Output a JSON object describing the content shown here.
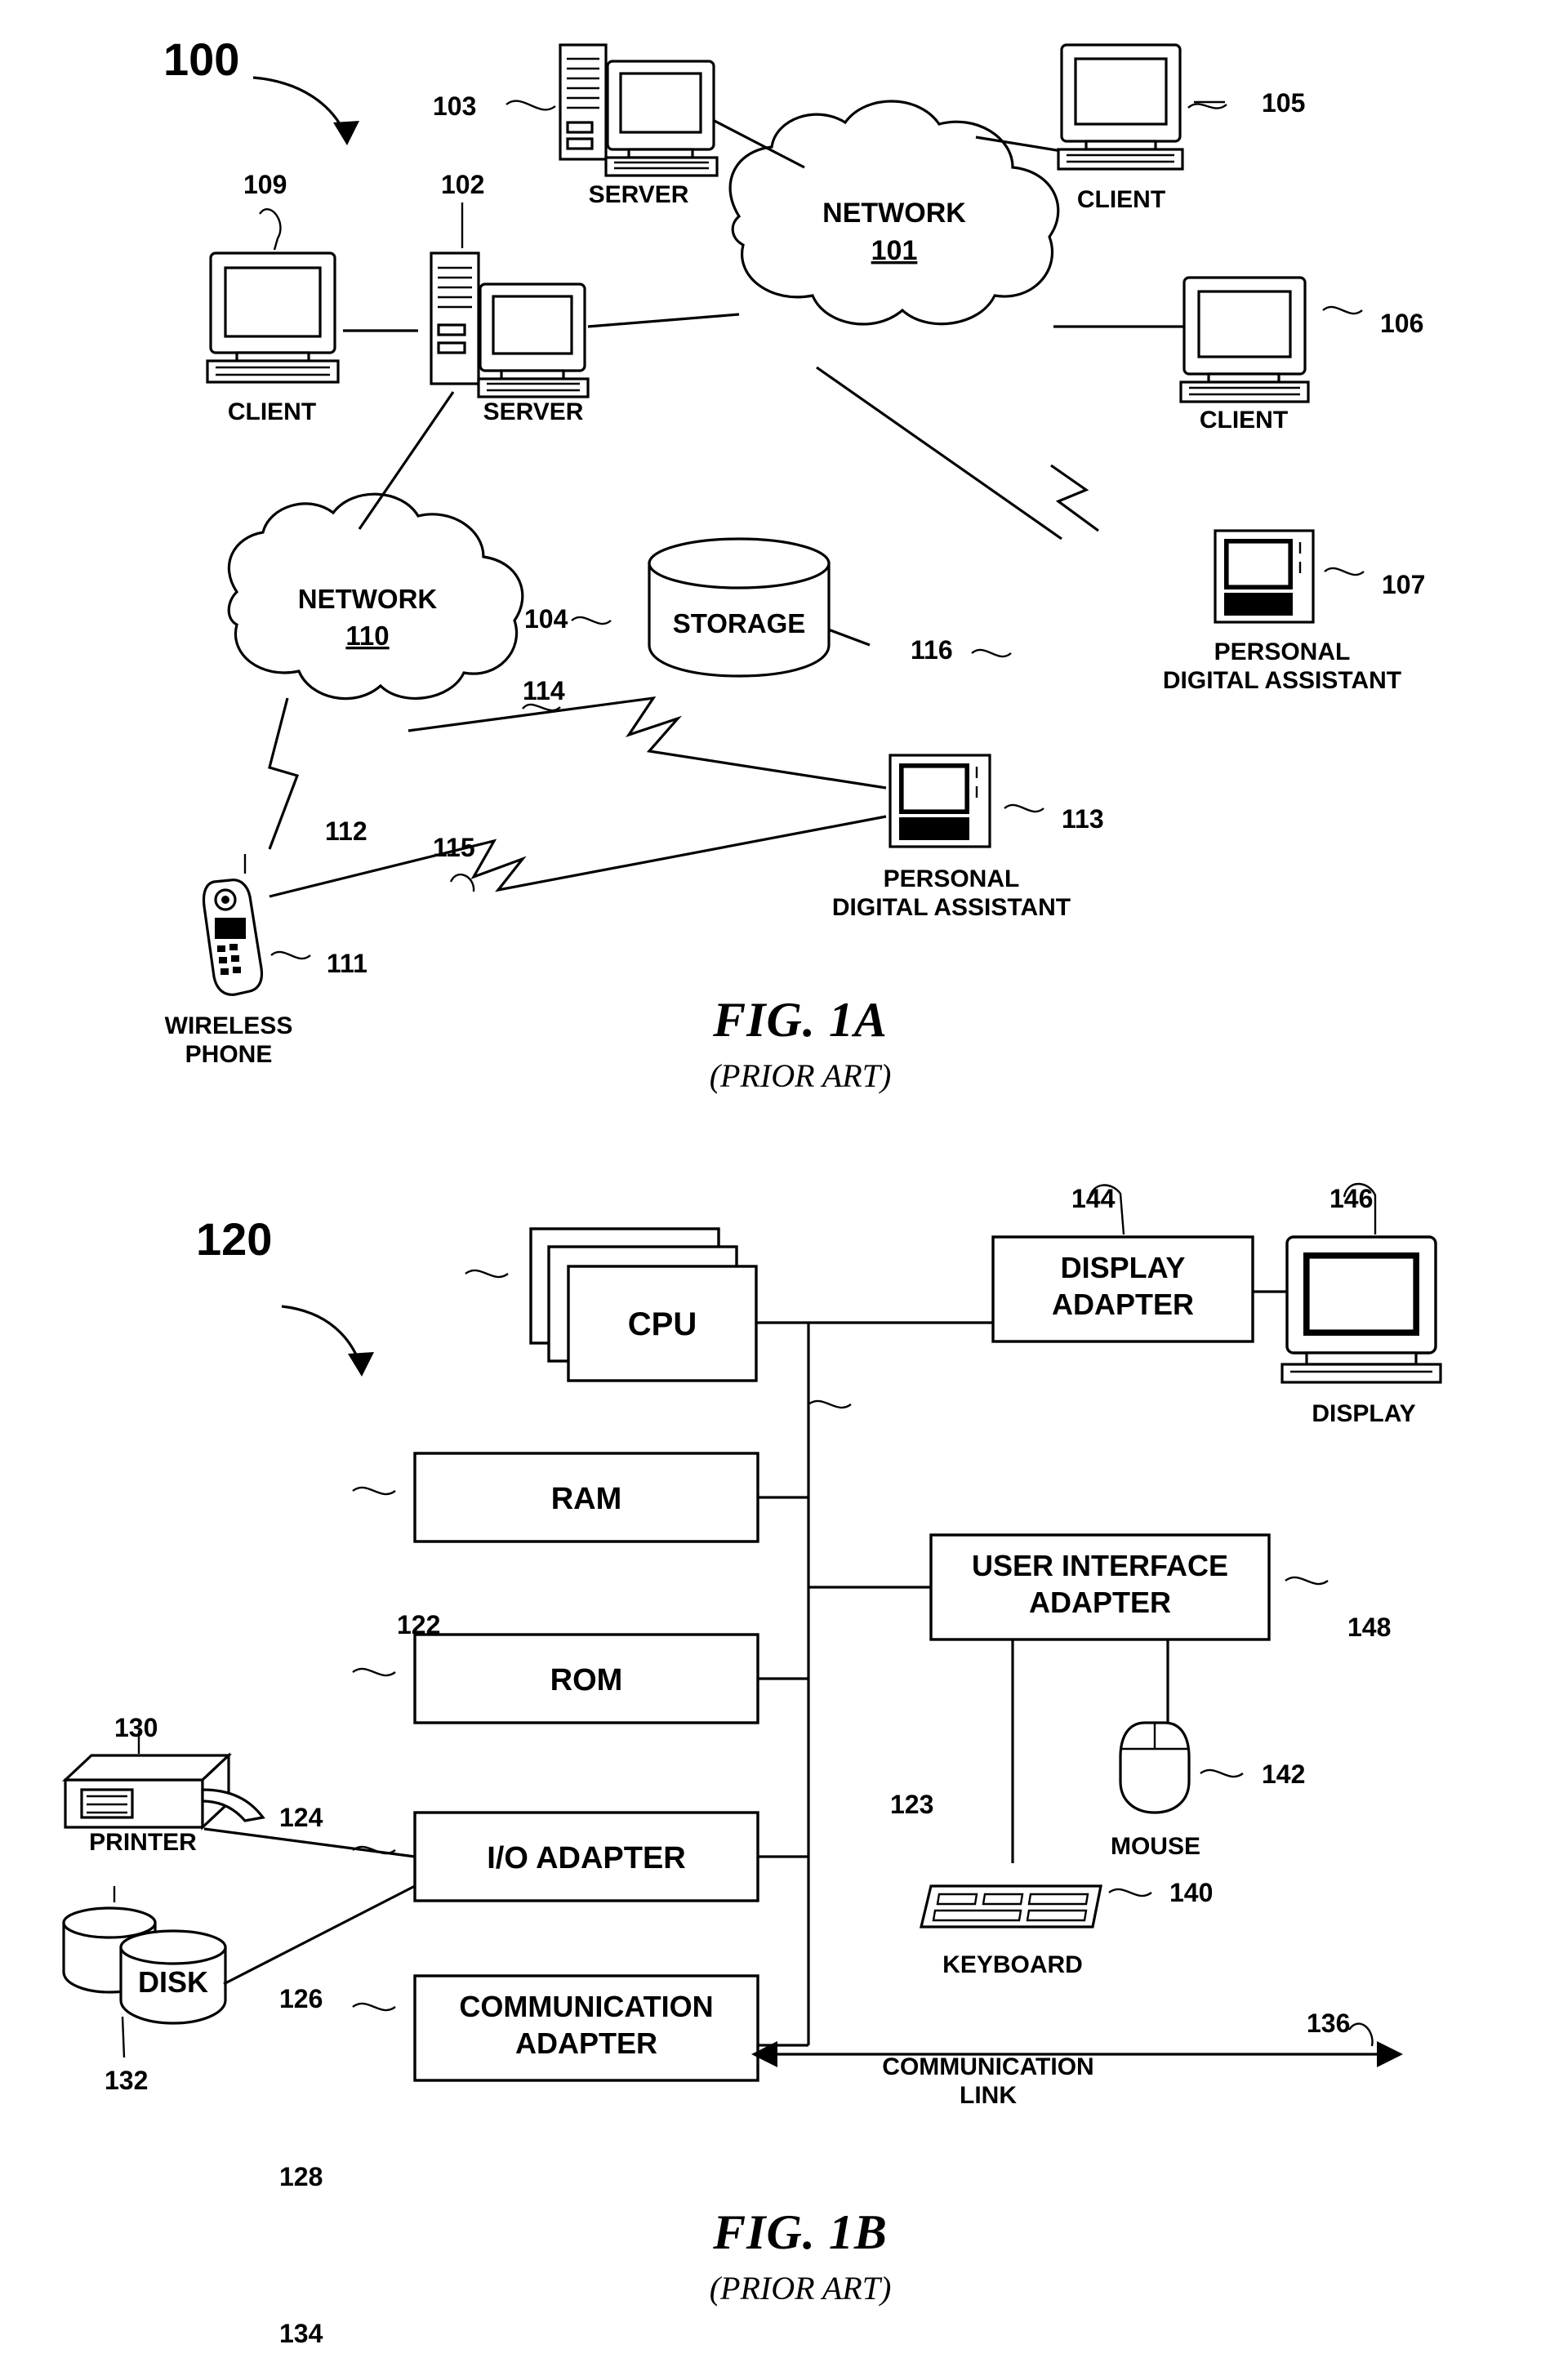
{
  "figures": [
    {
      "id": "fig-1a",
      "title": "FIG. 1A",
      "subtitle": "(PRIOR ART)",
      "diagram_number": "100",
      "nodes": [
        {
          "ref": "103",
          "label": "SERVER"
        },
        {
          "ref": "105",
          "label": "CLIENT"
        },
        {
          "ref": "109",
          "label": "CLIENT"
        },
        {
          "ref": "102",
          "label": "SERVER"
        },
        {
          "ref": "106",
          "label": "CLIENT"
        },
        {
          "ref": "101",
          "label": "NETWORK",
          "sublabel": "101"
        },
        {
          "ref": "110",
          "label": "NETWORK",
          "sublabel": "110"
        },
        {
          "ref": "104",
          "label": "STORAGE"
        },
        {
          "ref": "107",
          "label": "PERSONAL\nDIGITAL ASSISTANT"
        },
        {
          "ref": "113",
          "label": "PERSONAL\nDIGITAL ASSISTANT"
        },
        {
          "ref": "111",
          "label": "WIRELESS\nPHONE"
        }
      ],
      "links": [
        {
          "ref": "112"
        },
        {
          "ref": "114"
        },
        {
          "ref": "115"
        },
        {
          "ref": "116"
        }
      ]
    },
    {
      "id": "fig-1b",
      "title": "FIG. 1B",
      "subtitle": "(PRIOR ART)",
      "diagram_number": "120",
      "blocks": [
        {
          "ref": "122",
          "label": "CPU"
        },
        {
          "ref": "124",
          "label": "RAM"
        },
        {
          "ref": "126",
          "label": "ROM"
        },
        {
          "ref": "128",
          "label": "I/O ADAPTER"
        },
        {
          "ref": "134",
          "label": "COMMUNICATION\nADAPTER"
        },
        {
          "ref": "144",
          "label": "DISPLAY\nADAPTER"
        },
        {
          "ref": "148",
          "label": "USER INTERFACE\nADAPTER"
        }
      ],
      "peripherals": [
        {
          "ref": "146",
          "label": "DISPLAY"
        },
        {
          "ref": "142",
          "label": "MOUSE"
        },
        {
          "ref": "140",
          "label": "KEYBOARD"
        },
        {
          "ref": "130",
          "label": "PRINTER"
        },
        {
          "ref": "132",
          "label": "DISK"
        }
      ],
      "buses": [
        {
          "ref": "123",
          "label": ""
        },
        {
          "ref": "136",
          "label": "COMMUNICATION\nLINK"
        }
      ]
    }
  ],
  "text": {
    "fig1a_title": "FIG. 1A",
    "fig1a_sub": "(PRIOR ART)",
    "fig1b_title": "FIG. 1B",
    "fig1b_sub": "(PRIOR ART)",
    "n100": "100",
    "n120": "120",
    "server_103": "SERVER",
    "client_105": "CLIENT",
    "client_109": "CLIENT",
    "server_102": "SERVER",
    "client_106": "CLIENT",
    "network_101_name": "NETWORK",
    "network_101_num": "101",
    "network_110_name": "NETWORK",
    "network_110_num": "110",
    "storage_104": "STORAGE",
    "pda_107_l1": "PERSONAL",
    "pda_107_l2": "DIGITAL ASSISTANT",
    "pda_113_l1": "PERSONAL",
    "pda_113_l2": "DIGITAL ASSISTANT",
    "phone_111_l1": "WIRELESS",
    "phone_111_l2": "PHONE",
    "r103": "103",
    "r105": "105",
    "r109": "109",
    "r102": "102",
    "r106": "106",
    "r104": "104",
    "r107": "107",
    "r113": "113",
    "r111": "111",
    "r112": "112",
    "r114": "114",
    "r115": "115",
    "r116": "116",
    "cpu": "CPU",
    "ram": "RAM",
    "rom": "ROM",
    "io_adapter": "I/O ADAPTER",
    "comm_adapter_l1": "COMMUNICATION",
    "comm_adapter_l2": "ADAPTER",
    "display_adapter_l1": "DISPLAY",
    "display_adapter_l2": "ADAPTER",
    "ui_adapter_l1": "USER INTERFACE",
    "ui_adapter_l2": "ADAPTER",
    "display": "DISPLAY",
    "mouse": "MOUSE",
    "keyboard": "KEYBOARD",
    "printer": "PRINTER",
    "disk": "DISK",
    "comm_link_l1": "COMMUNICATION",
    "comm_link_l2": "LINK",
    "r122": "122",
    "r123": "123",
    "r124": "124",
    "r126": "126",
    "r128": "128",
    "r130": "130",
    "r132": "132",
    "r134": "134",
    "r136": "136",
    "r140": "140",
    "r142": "142",
    "r144": "144",
    "r146": "146",
    "r148": "148"
  }
}
